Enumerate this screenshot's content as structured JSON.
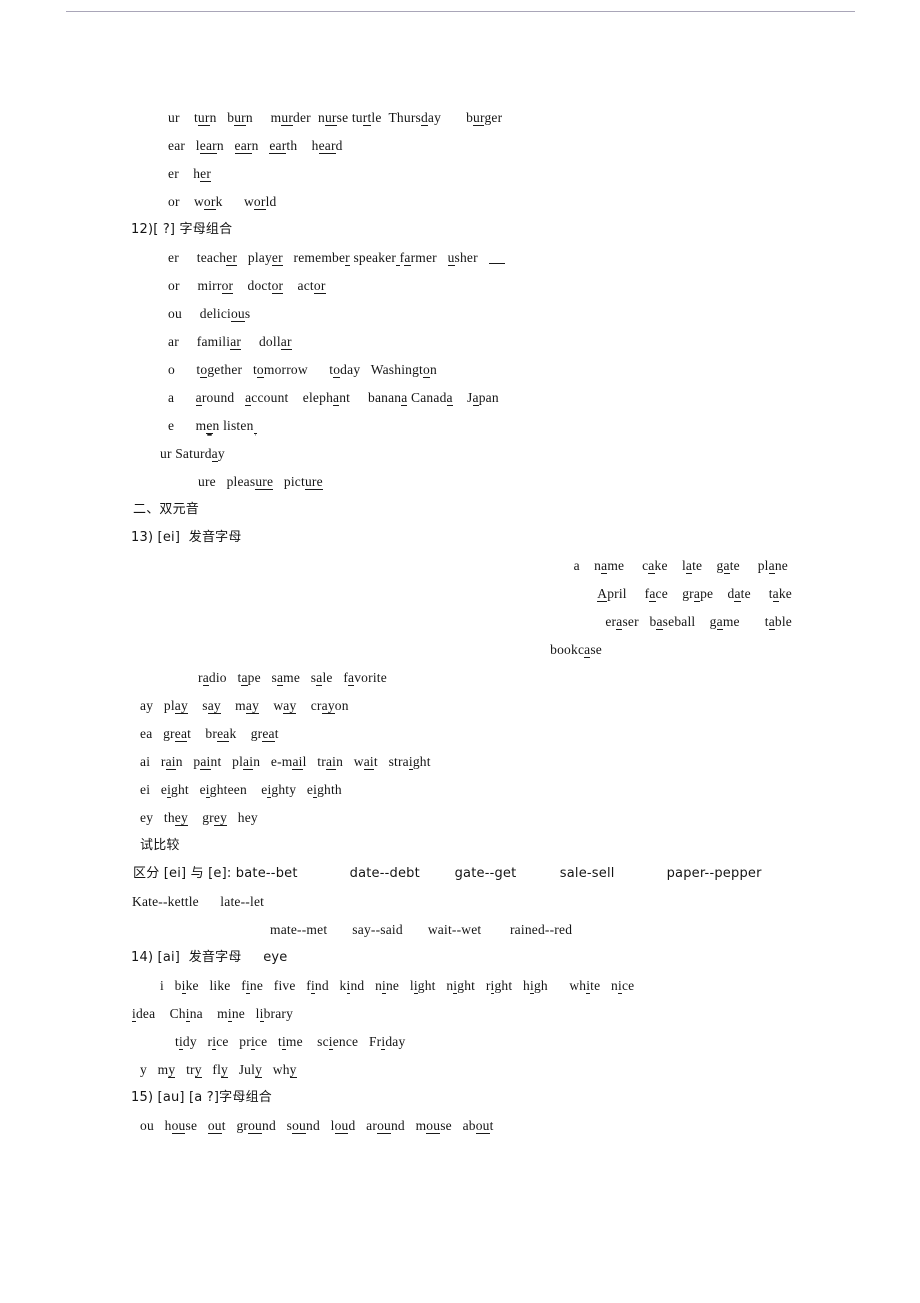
{
  "document": {
    "type": "english-phonetics-worksheet",
    "language": "zh-CN + en",
    "rule_color": "#9a97ab"
  },
  "lines": {
    "l_ur": "ur    t<u>ur</u>n   b<u>ur</u>n     m<u>ur</u>der  n<u>ur</u>se tu<u>rt</u>le  Thurs<u>d</u>ay       b<u>ur</u>ger",
    "l_ear": "ear   l<u>ear</u>n   <u>ear</u>n   <u>ear</u>th    h<u>ear</u>d",
    "l_er1": "er    h<u>er</u>",
    "l_or1": "or    w<u>or</u>k      w<u>or</u>ld",
    "h12": "12)[ ?] 字母组合",
    "l_er2": "er     teach<u>er</u>   play<u>er</u>   remembe<u>r</u> speaker<u> </u>f<u>a</u>rmer   <u>u</u>sher   <span class=\"blank\"></span>",
    "l_or2": "or     mirr<u>or</u>    doct<u>or</u>    act<u>or</u>",
    "l_ou": "ou     delici<u>ou</u>s",
    "l_ar": "ar     famili<u>ar</u>     doll<u>ar</u>",
    "l_o": "o      t<u>o</u>gether   t<u>o</u>morrow      t<u>o</u>day   Washingt<u>o</u>n",
    "l_a": "a      <u>a</u>round   <u>a</u>ccount    eleph<u>a</u>nt     banan<u>a</u> Canad<u>a</u>    J<u>a</u>pan",
    "l_e": "e      m<u class=\"dbl\">e</u>n listen<u class=\"dbl\"> </u>",
    "l_ursat": "ur Saturd<u>a</u>y",
    "l_ure": "ure   pleas<u>ure</u>   pict<u>ure</u>",
    "h_section2": "二、双元音",
    "h13": "13) [ei]  发音字母",
    "l_a1": "a    n<u>a</u>me     c<u>a</u>ke    l<u>a</u>te    g<u>a</u>te     pl<u>a</u>ne",
    "l_a2": "<u>A</u>pril     f<u>a</u>ce    gr<u>a</u>pe    d<u>a</u>te     t<u>a</u>ke",
    "l_a3": "er<u>a</u>ser   b<u>a</u>seball    g<u>a</u>me       t<u>a</u>ble",
    "l_a4": "bookc<u>a</u>se",
    "l_a5": "r<u>a</u>dio   t<u>a</u>pe   s<u>a</u>me   s<u>a</u>le   f<u>a</u>vorite",
    "l_ay": "ay   pl<u>ay</u>    s<u>ay</u>    m<u>ay</u>    w<u>ay</u>    cr<u>ay</u>on",
    "l_ea": "ea   gr<u>ea</u>t    br<u>ea</u>k    gr<u>ea</u>t",
    "l_ai": "ai   r<u>ai</u>n   p<u>ai</u>nt   pl<u>ai</u>n   e-m<u>ai</u>l   tr<u>ai</u>n   w<u>ai</u>t   stra<u>i</u>ght",
    "l_ei": "ei   e<u>i</u>ght   e<u>i</u>ghteen    e<u>i</u>ghty   e<u>i</u>ghth",
    "l_ey": "ey   th<u>ey</u>    gr<u>ey</u>   hey",
    "h_compare": "试比较",
    "l_cmp1": "区分 [ei] 与 [e]: bate--bet            date--debt        gate--get          sale-sell            paper--pepper",
    "l_cmp2": "Kate--kettle      late--let",
    "l_cmp3": "mate--met       say--said       wait--wet        rained--red",
    "h14": "14) [ai]  发音字母     eye",
    "l_i1": "i   b<u>i</u>ke   like   f<u>i</u>ne   five   f<u>i</u>nd   k<u>i</u>nd   n<u>i</u>ne   l<u>i</u>ght   n<u>i</u>ght   r<u>i</u>ght   h<u>i</u>gh      wh<u>i</u>te   n<u>i</u>ce",
    "l_i2": "<u>i</u>dea    Ch<u>i</u>na    m<u>i</u>ne   l<u>i</u>brary",
    "l_i3": "t<u>i</u>dy   r<u>i</u>ce   pr<u>i</u>ce   t<u>i</u>me    sc<u>i</u>ence   Fr<u>i</u>day",
    "l_y": "y   m<u>y</u>   tr<u>y</u>   fl<u>y</u>   Jul<u>y</u>   wh<u>y</u>",
    "h15": "15) [au] [a ?]字母组合",
    "l_ou2": "ou   h<u>ou</u>se   <u>ou</u>t   gr<u>ou</u>nd   s<u>ou</u>nd   l<u>ou</u>d   ar<u>ou</u>nd   m<u>ou</u>se   ab<u>ou</u>t"
  }
}
